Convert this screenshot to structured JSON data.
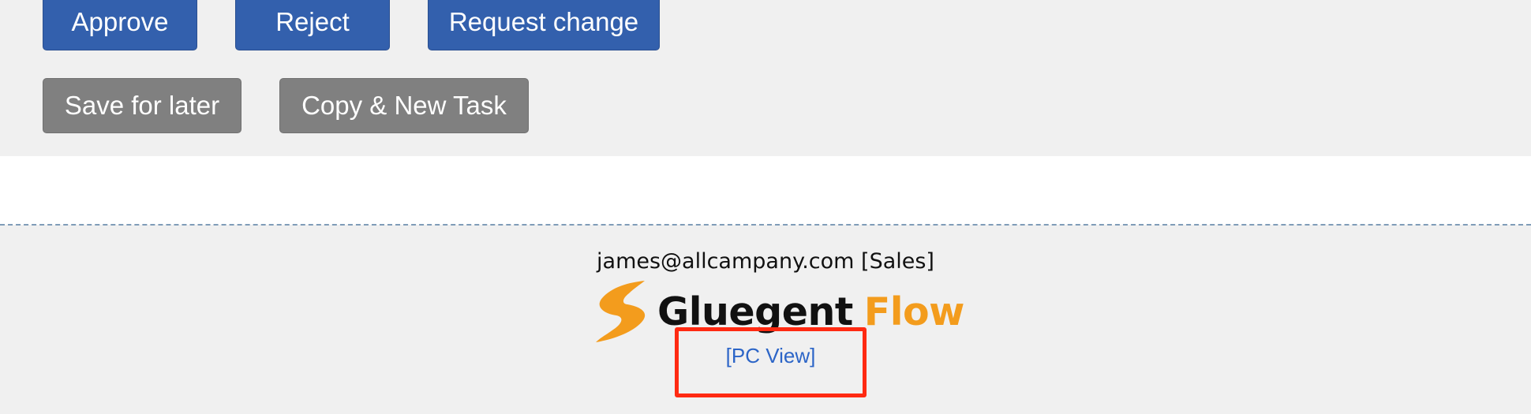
{
  "actions": {
    "approve_label": "Approve",
    "reject_label": "Reject",
    "request_change_label": "Request change",
    "save_for_later_label": "Save for later",
    "copy_new_task_label": "Copy & New Task"
  },
  "footer": {
    "user_info": "james@allcampany.com [Sales]",
    "logo": {
      "word1": "Gluegent",
      "word2": "Flow",
      "icon": "gluegent-flow-logo-icon"
    },
    "pc_view_link": "[PC View]"
  },
  "colors": {
    "primary_button": "#3360ad",
    "secondary_button": "#808080",
    "logo_orange": "#f39c1d",
    "link": "#2c65c7",
    "highlight_box": "#ff2a12",
    "background": "#f0f0f0"
  }
}
